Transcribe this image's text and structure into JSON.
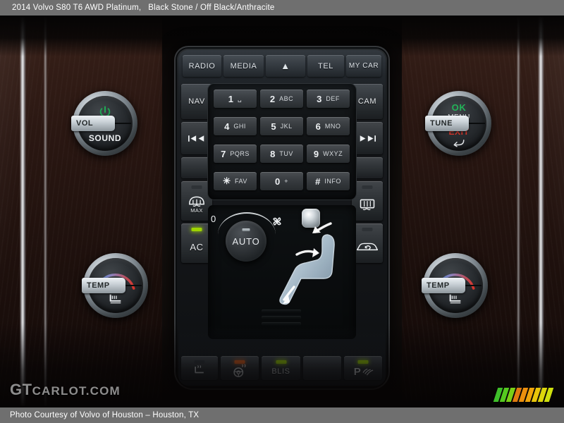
{
  "header": {
    "vehicle": "2014 Volvo S80 T6 AWD Platinum,",
    "colors": "Black Stone / Off Black/Anthracite"
  },
  "footer": {
    "credit": "Photo Courtesy of Volvo of Houston – Houston, TX"
  },
  "watermark": {
    "part1": "GT",
    "part2": "CARLOT.COM"
  },
  "stripes": {
    "colors": [
      "#3fbf2a",
      "#55c91f",
      "#7ad016",
      "#e07a10",
      "#ec8f0d",
      "#f0a50b",
      "#e8c50a",
      "#ddd60c",
      "#cfe00e"
    ]
  },
  "infotainment": {
    "top_row": [
      {
        "label": "RADIO",
        "name": "radio-button"
      },
      {
        "label": "MEDIA",
        "name": "media-button"
      },
      {
        "label": "▲",
        "name": "eject-button"
      },
      {
        "label": "TEL",
        "name": "tel-button"
      },
      {
        "label": "MY CAR",
        "name": "my-car-button"
      }
    ],
    "left_column": [
      {
        "label": "NAV",
        "name": "nav-button"
      },
      {
        "label": "◀◀",
        "name": "previous-track-button"
      }
    ],
    "right_column": [
      {
        "label": "CAM",
        "name": "cam-button"
      },
      {
        "label": "▶▶",
        "name": "next-track-button"
      }
    ],
    "keypad": [
      {
        "num": "1",
        "letters": "␣"
      },
      {
        "num": "2",
        "letters": "ABC"
      },
      {
        "num": "3",
        "letters": "DEF"
      },
      {
        "num": "4",
        "letters": "GHI"
      },
      {
        "num": "5",
        "letters": "JKL"
      },
      {
        "num": "6",
        "letters": "MNO"
      },
      {
        "num": "7",
        "letters": "PQRS"
      },
      {
        "num": "8",
        "letters": "TUV"
      },
      {
        "num": "9",
        "letters": "WXYZ"
      },
      {
        "num": "✳",
        "letters": "FAV"
      },
      {
        "num": "0",
        "letters": "+"
      },
      {
        "num": "#",
        "letters": "INFO"
      }
    ]
  },
  "knobs": {
    "volume": {
      "lever_label": "VOL",
      "bottom_label": "SOUND",
      "power_icon": "power-icon",
      "power_color": "#1faa55"
    },
    "menu": {
      "lever_label": "TUNE",
      "top_label": "OK",
      "sub_label": "MENU",
      "bottom_label": "EXIT",
      "back_icon": "back-arrow-icon",
      "ok_color": "#22b358",
      "exit_color": "#d8352a"
    },
    "temp_left": {
      "lever_label": "TEMP",
      "seat_icon": "heated-seat-icon",
      "cold_color": "#4f8fe0",
      "hot_color": "#d6342a"
    },
    "temp_right": {
      "lever_label": "TEMP",
      "seat_icon": "heated-seat-icon",
      "cold_color": "#4f8fe0",
      "hot_color": "#d6342a"
    }
  },
  "climate": {
    "fan_knob_label": "AUTO",
    "fan_min_label": "0",
    "fan_max_icon": "fan-icon",
    "ac_button": {
      "label": "AC",
      "led": "green",
      "name": "ac-button"
    },
    "defrost_max_button": {
      "label": "MAX",
      "icon": "front-defrost-icon",
      "led": "dark",
      "name": "front-defrost-button"
    },
    "rear_defrost_button": {
      "icon": "rear-defrost-icon",
      "led": "dark",
      "name": "rear-defrost-button"
    },
    "recirculation_button": {
      "icon": "recirculation-icon",
      "led": "dark",
      "name": "recirculation-button"
    },
    "airflow_direction_button": {
      "name": "airflow-direction-button"
    },
    "seat_diagram": "seat-airflow-diagram"
  },
  "bottom_row": [
    {
      "label": "",
      "icon": "rear-seat-heat-icon",
      "led": "dark",
      "name": "rear-seat-heat-button"
    },
    {
      "label": "",
      "icon": "heated-steering-wheel-icon",
      "led": "orange",
      "name": "heated-steering-wheel-button"
    },
    {
      "label": "BLIS",
      "icon": "",
      "led": "green",
      "name": "blis-button"
    },
    {
      "label": "",
      "icon": "",
      "led": "none",
      "name": "blank-button"
    },
    {
      "label": "",
      "icon": "park-assist-icon",
      "led": "green",
      "name": "park-assist-button"
    }
  ]
}
